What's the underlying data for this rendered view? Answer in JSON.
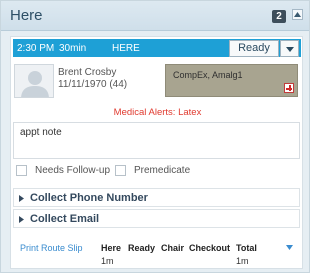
{
  "panel": {
    "title": "Here",
    "count": "2"
  },
  "card": {
    "status": {
      "time": "2:30 PM",
      "duration": "30min",
      "location": "HERE",
      "ready_label": "Ready"
    },
    "patient": {
      "name": "Brent Crosby",
      "dob_age": "11/11/1970  (44)"
    },
    "alert_box": {
      "text": "CompEx, Amalg1"
    },
    "medical_alerts": "Medical Alerts: Latex",
    "note": "appt note",
    "checkboxes": [
      {
        "label": "Needs Follow-up",
        "checked": false
      },
      {
        "label": "Premedicate",
        "checked": false
      }
    ],
    "sections": [
      {
        "label": "Collect Phone Number"
      },
      {
        "label": "Collect Email"
      }
    ],
    "footer": {
      "print_label": "Print Route Slip",
      "columns": [
        {
          "header": "Here",
          "value": "1m"
        },
        {
          "header": "Ready",
          "value": ""
        },
        {
          "header": "Chair",
          "value": ""
        },
        {
          "header": "Checkout",
          "value": ""
        },
        {
          "header": "Total",
          "value": "1m"
        }
      ]
    }
  },
  "colors": {
    "status_bar": "#1ea0d6",
    "alert_text": "#e03a2f",
    "alert_box_bg": "#a8a490",
    "link": "#3a8ccf"
  }
}
